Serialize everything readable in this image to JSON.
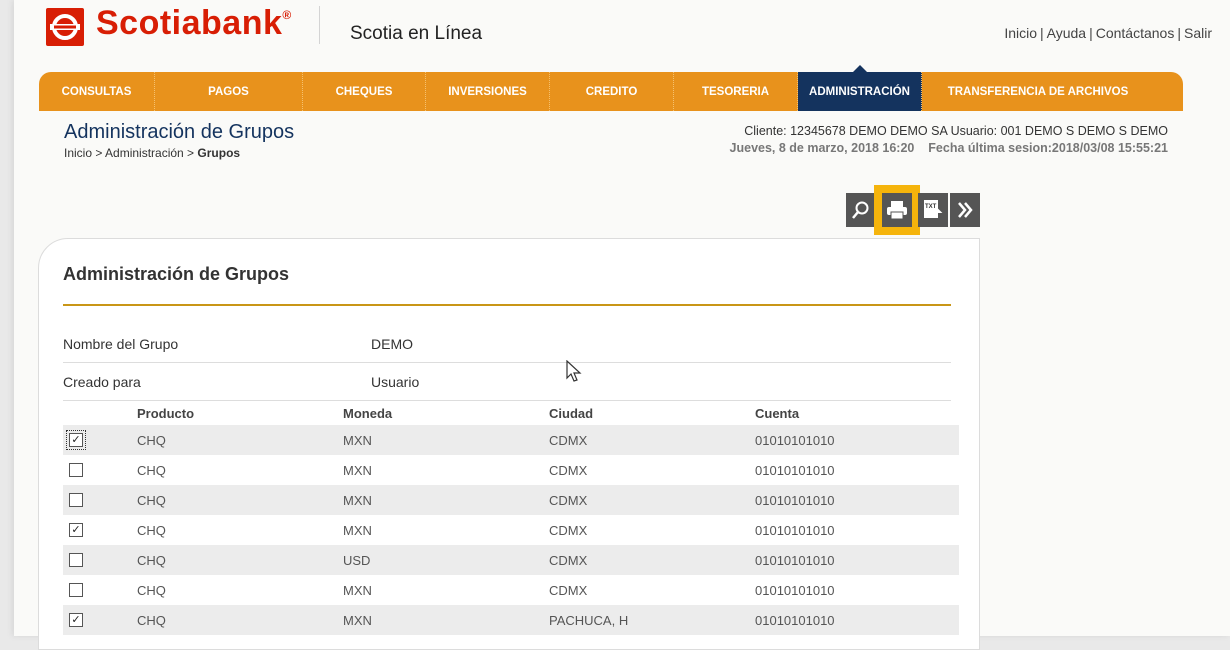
{
  "brand": {
    "name": "Scotiabank",
    "reg": "®",
    "app_name": "Scotia en Línea",
    "color": "#d81e05"
  },
  "top_links": [
    "Inicio",
    "Ayuda",
    "Contáctanos",
    "Salir"
  ],
  "nav": {
    "items": [
      "CONSULTAS",
      "PAGOS",
      "CHEQUES",
      "INVERSIONES",
      "CREDITO",
      "TESORERIA",
      "ADMINISTRACIÓN",
      "TRANSFERENCIA DE ARCHIVOS"
    ],
    "active": "ADMINISTRACIÓN",
    "color": "#e8921c",
    "active_color": "#14335e"
  },
  "page": {
    "title": "Administración de Grupos",
    "breadcrumb": {
      "prefix": "Inicio > Administración > ",
      "current": "Grupos"
    }
  },
  "client": {
    "line1": "Cliente: 12345678  DEMO DEMO SA    Usuario: 001 DEMO S DEMO S DEMO",
    "date": "Jueves, 8 de marzo, 2018 16:20",
    "last_session": "Fecha última sesion:2018/03/08 15:55:21"
  },
  "toolbar": {
    "buttons": [
      "search-icon",
      "print-icon",
      "txt-export-icon",
      "forward-icon"
    ],
    "highlighted": "print-icon"
  },
  "panel": {
    "title": "Administración de Grupos",
    "fields": [
      {
        "label": "Nombre del Grupo",
        "value": "DEMO"
      },
      {
        "label": "Creado para",
        "value": "Usuario"
      }
    ],
    "columns": [
      "Producto",
      "Moneda",
      "Ciudad",
      "Cuenta"
    ],
    "rows": [
      {
        "checked": true,
        "producto": "CHQ",
        "moneda": "MXN",
        "ciudad": "CDMX",
        "cuenta": "01010101010"
      },
      {
        "checked": false,
        "producto": "CHQ",
        "moneda": "MXN",
        "ciudad": "CDMX",
        "cuenta": "01010101010"
      },
      {
        "checked": false,
        "producto": "CHQ",
        "moneda": "MXN",
        "ciudad": "CDMX",
        "cuenta": "01010101010"
      },
      {
        "checked": true,
        "producto": "CHQ",
        "moneda": "MXN",
        "ciudad": "CDMX",
        "cuenta": "01010101010"
      },
      {
        "checked": false,
        "producto": "CHQ",
        "moneda": "USD",
        "ciudad": "CDMX",
        "cuenta": "01010101010"
      },
      {
        "checked": false,
        "producto": "CHQ",
        "moneda": "MXN",
        "ciudad": "CDMX",
        "cuenta": "01010101010"
      },
      {
        "checked": true,
        "producto": "CHQ",
        "moneda": "MXN",
        "ciudad": "PACHUCA, H",
        "cuenta": "01010101010"
      }
    ]
  }
}
